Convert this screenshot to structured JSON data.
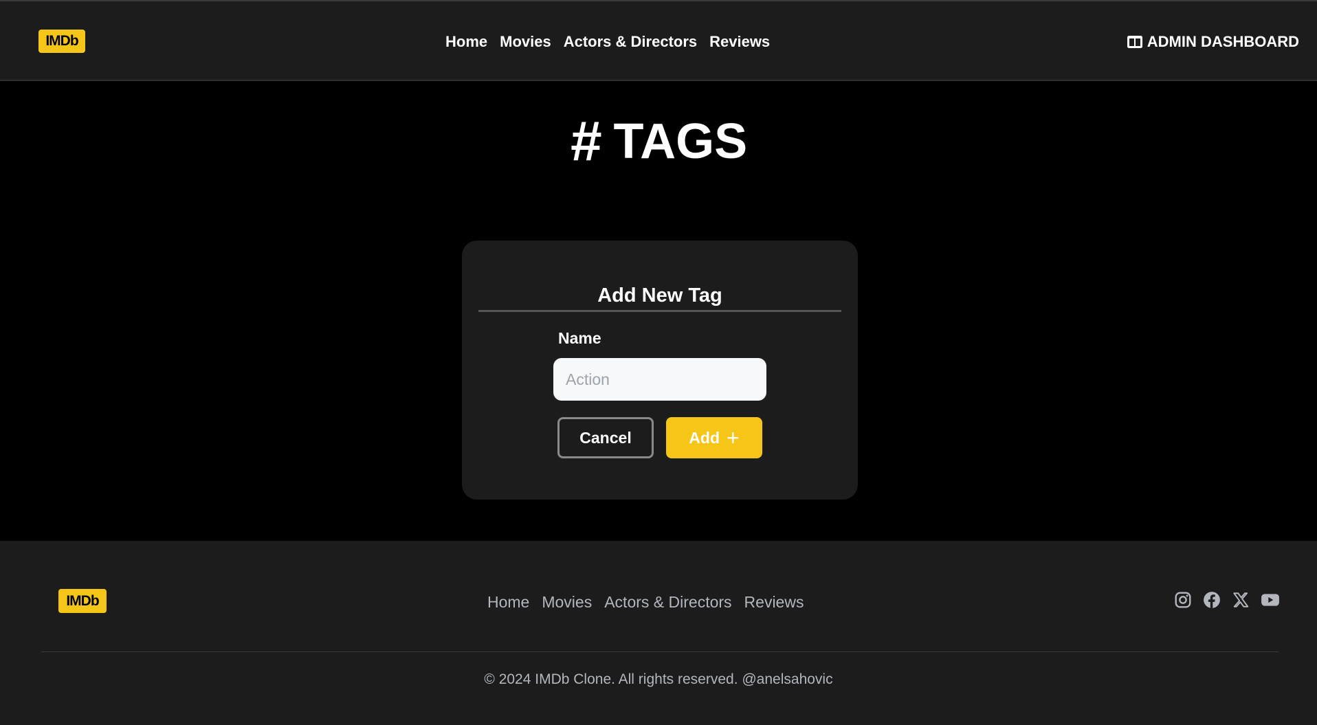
{
  "header": {
    "logo_text": "IMDb",
    "nav": [
      "Home",
      "Movies",
      "Actors & Directors",
      "Reviews"
    ],
    "admin_label": "ADMIN DASHBOARD",
    "admin_icon": "columns-icon"
  },
  "page": {
    "title": "TAGS",
    "title_icon": "hash-icon"
  },
  "form": {
    "title": "Add New Tag",
    "name_label": "Name",
    "name_value": "",
    "name_placeholder": "Action",
    "cancel_label": "Cancel",
    "add_label": "Add",
    "add_icon": "plus-icon"
  },
  "footer": {
    "logo_text": "IMDb",
    "nav": [
      "Home",
      "Movies",
      "Actors & Directors",
      "Reviews"
    ],
    "social_icons": [
      "instagram-icon",
      "facebook-icon",
      "x-icon",
      "youtube-icon"
    ],
    "copyright": "© 2024 IMDb Clone. All rights reserved. @anelsahovic"
  },
  "colors": {
    "accent": "#f5c518",
    "surface": "#1c1c1c",
    "background": "#000000",
    "muted_text": "#b3b7bd"
  }
}
